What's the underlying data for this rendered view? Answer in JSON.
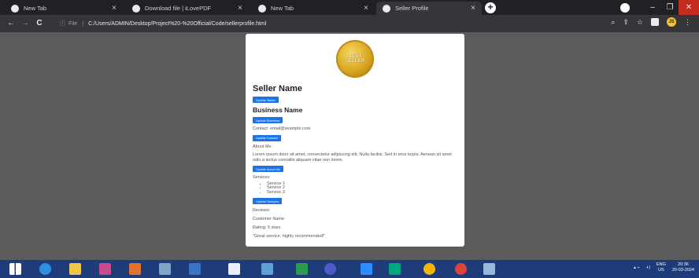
{
  "tabs": [
    {
      "title": "New Tab",
      "close": "×"
    },
    {
      "title": "Download file | iLovePDF",
      "close": "×"
    },
    {
      "title": "New Tab",
      "close": "×"
    },
    {
      "title": "Seller Profile",
      "close": "×"
    }
  ],
  "new_tab_label": "+",
  "window_controls": {
    "minimize": "–",
    "maximize": "❐",
    "close": "✕"
  },
  "toolbar": {
    "back": "←",
    "forward": "→",
    "reload": "C",
    "info": "ⓘ",
    "file_label": "File",
    "url": "C:/Users/ADMIN/Desktop/Project%20-%20Official/Code/sellerprofile.html",
    "zoom_icon": "⌕",
    "share_icon": "⇪",
    "star_icon": "☆",
    "profile_initials": "JS",
    "menu_icon": "⋮"
  },
  "badge": {
    "line1": "BEST",
    "line2": "SELLER"
  },
  "profile": {
    "seller_name": "Seller Name",
    "update_name": "Update Name",
    "business_name": "Business Name",
    "update_business": "Update Business",
    "contact": "Contact: email@example.com",
    "update_contact": "Update Contact",
    "about_heading": "About Me:",
    "about_text": "Lorem ipsum dolor sit amet, consectetur adipiscing elit. Nulla facilisi. Sed in eros turpis. Aenean sit amet odio a lectus convallis aliquam vitae non lorem.",
    "update_about": "Update About Me",
    "services_heading": "Services:",
    "services": [
      "Service 1",
      "Service 2",
      "Service 3"
    ],
    "update_services": "Update Services",
    "reviews_heading": "Reviews:",
    "reviewer": "Customer Name",
    "rating": "Rating: 5 stars",
    "review_text": "\"Great service, highly recommended!\""
  },
  "taskbar": {
    "icons": [
      "windows-start-icon",
      "internet-explorer-icon",
      "file-explorer-icon",
      "media-player-icon",
      "paint-icon",
      "network-icon",
      "photos-icon",
      "word-icon",
      "notepad-icon",
      "excel-icon",
      "teams-icon",
      "zoom-icon",
      "meet-icon",
      "chrome-icon",
      "chrome-icon",
      "terminal-icon"
    ],
    "lang_top": "ENG",
    "lang_bottom": "US",
    "time": "20:36",
    "date": "20-03-2024"
  },
  "colors": {
    "accent_button": "#1a73e8",
    "badge_gold": "#d7a520",
    "taskbar": "#1e3b7a"
  }
}
